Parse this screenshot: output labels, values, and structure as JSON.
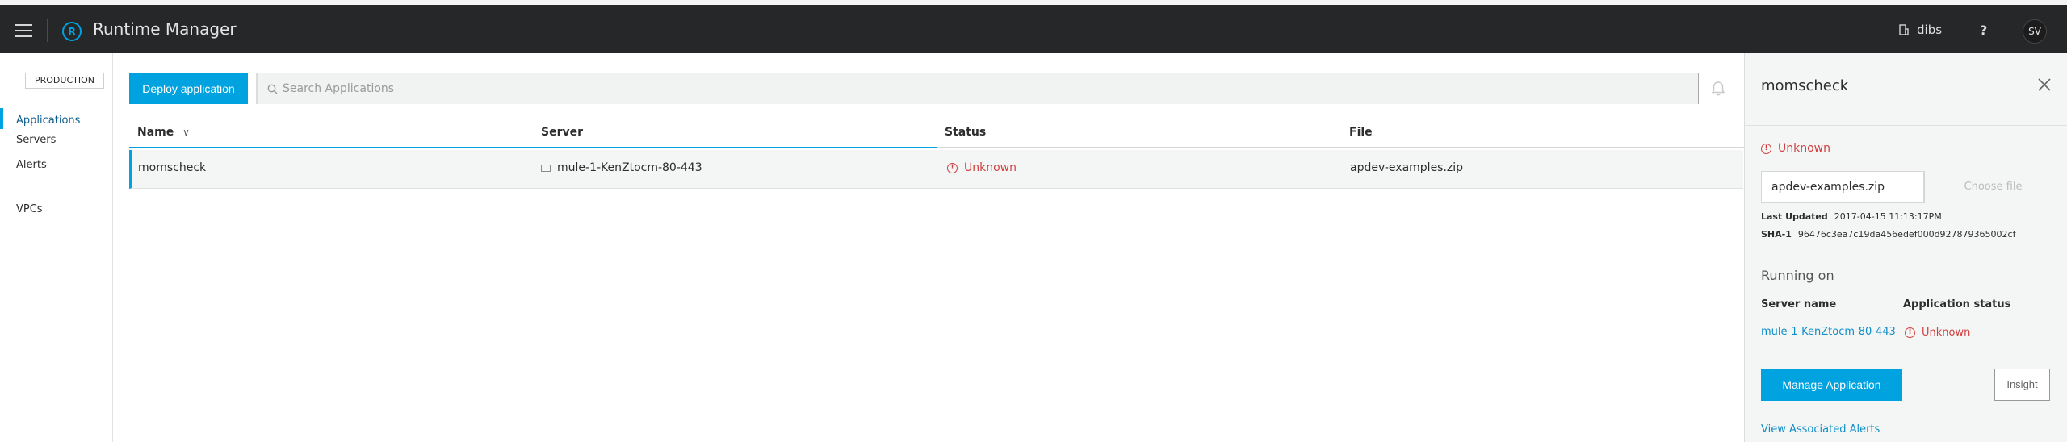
{
  "header": {
    "app_title": "Runtime Manager",
    "org_name": "dibs",
    "help_label": "?",
    "user_initials": "SV"
  },
  "sidebar": {
    "environment": "PRODUCTION",
    "items": [
      {
        "label": "Applications",
        "active": true
      },
      {
        "label": "Servers",
        "active": false
      },
      {
        "label": "Alerts",
        "active": false
      },
      {
        "label": "VPCs",
        "active": false
      }
    ]
  },
  "toolbar": {
    "deploy_label": "Deploy application",
    "search_placeholder": "Search Applications"
  },
  "table": {
    "columns": [
      "Name",
      "Server",
      "Status",
      "File"
    ],
    "sort_indicator": "∨",
    "rows": [
      {
        "name": "momscheck",
        "server": "mule-1-KenZtocm-80-443",
        "status": "Unknown",
        "file": "apdev-examples.zip"
      }
    ]
  },
  "detail_panel": {
    "title": "momscheck",
    "status": "Unknown",
    "file_name": "apdev-examples.zip",
    "choose_file_label": "Choose file",
    "last_updated_label": "Last Updated",
    "last_updated_value": "2017-04-15 11:13:17PM",
    "sha_label": "SHA-1",
    "sha_value": "96476c3ea7c19da456edef000d927879365002cf",
    "running_on_label": "Running on",
    "server_name_header": "Server name",
    "app_status_header": "Application status",
    "server_name": "mule-1-KenZtocm-80-443",
    "app_status": "Unknown",
    "manage_label": "Manage Application",
    "insight_label": "Insight",
    "alerts_link": "View Associated Alerts"
  },
  "colors": {
    "accent": "#00a2df",
    "topbar": "#262728",
    "error": "#d13f3f",
    "link": "#0f8fc7"
  }
}
